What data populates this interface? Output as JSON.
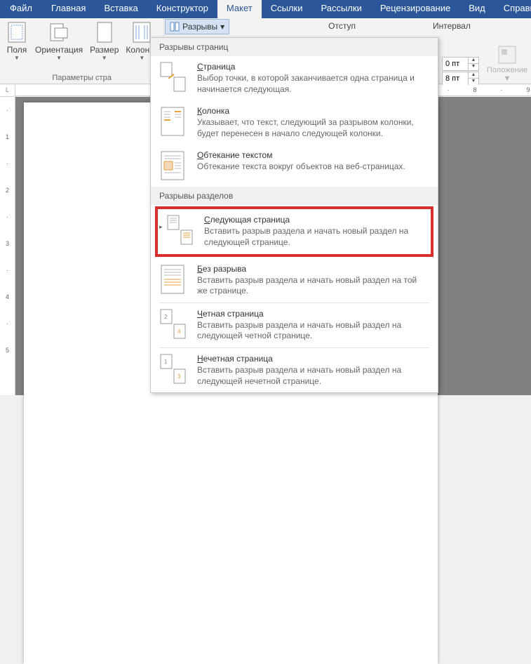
{
  "tabs": {
    "file": "Файл",
    "home": "Главная",
    "insert": "Вставка",
    "design": "Конструктор",
    "layout": "Макет",
    "references": "Ссылки",
    "mailings": "Рассылки",
    "review": "Рецензирование",
    "view": "Вид",
    "help": "Справка"
  },
  "groups": {
    "page_setup_title": "Параметры стра",
    "margins": "Поля",
    "orientation": "Ориентация",
    "size": "Размер",
    "columns": "Колонки",
    "breaks": "Разрывы",
    "indent_label": "Отступ",
    "interval_label": "Интервал",
    "position": "Положение"
  },
  "spacing": {
    "before": "0 пт",
    "after": "8 пт"
  },
  "dropdown": {
    "section1_title": "Разрывы страниц",
    "section2_title": "Разрывы разделов",
    "items": [
      {
        "title_u": "С",
        "title_rest": "траница",
        "desc": "Выбор точки, в которой заканчивается одна страница и начинается следующая."
      },
      {
        "title_u": "К",
        "title_rest": "олонка",
        "desc": "Указывает, что текст, следующий за разрывом колонки, будет перенесен в начало следующей колонки."
      },
      {
        "title_u": "О",
        "title_rest": "бтекание текстом",
        "desc": "Обтекание текста вокруг объектов на веб-страницах."
      }
    ],
    "items2": [
      {
        "title_u": "С",
        "title_rest": "ледующая страница",
        "desc": "Вставить разрыв раздела и начать новый раздел на следующей странице."
      },
      {
        "title_u": "Б",
        "title_rest": "ез разрыва",
        "desc": "Вставить разрыв раздела и начать новый раздел на той же странице."
      },
      {
        "title_u": "Ч",
        "title_rest": "етная страница",
        "desc": "Вставить разрыв раздела и начать новый раздел на следующей четной странице."
      },
      {
        "title_u": "Н",
        "title_rest": "ечетная страница",
        "desc": "Вставить разрыв раздела и начать новый раздел на следующей нечетной странице."
      }
    ]
  },
  "ruler_corner": "L"
}
